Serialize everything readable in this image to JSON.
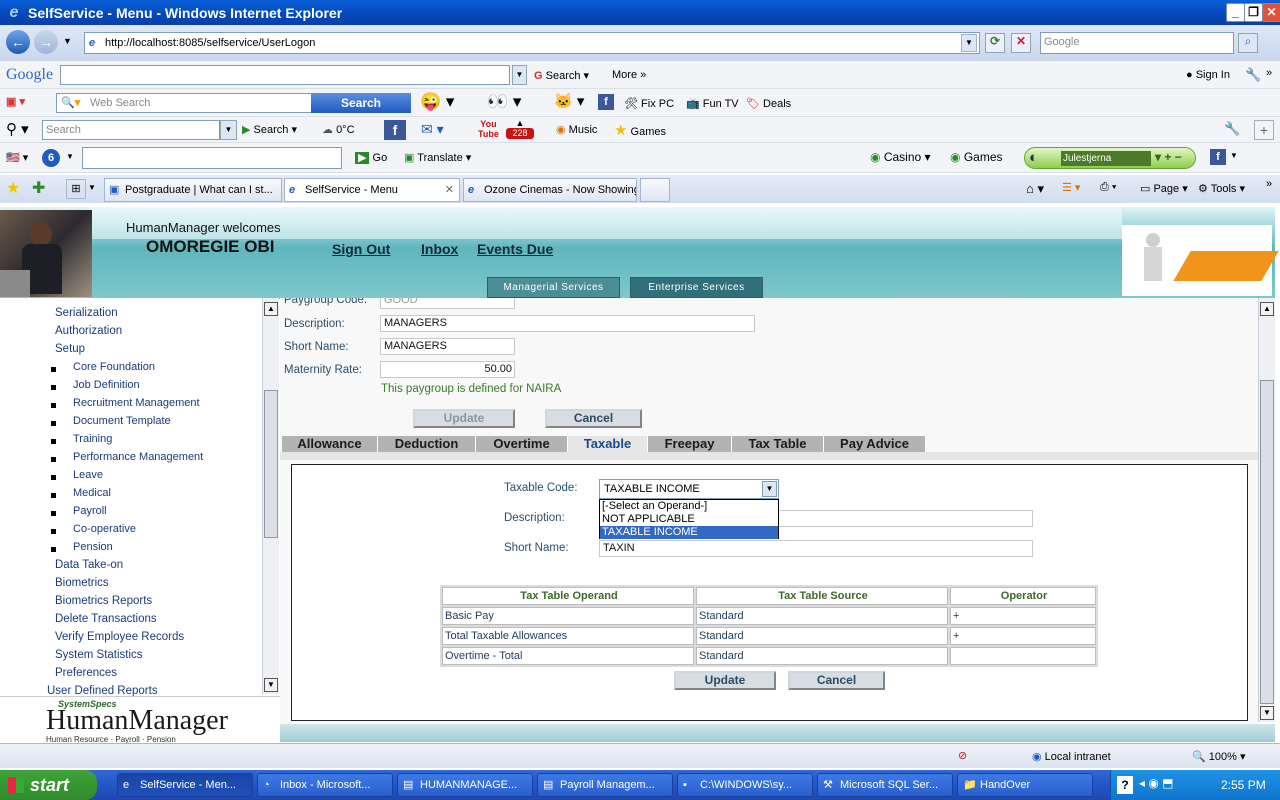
{
  "window": {
    "title": "SelfService - Menu - Windows Internet Explorer"
  },
  "address_bar": {
    "url": "http://localhost:8085/selfservice/UserLogon",
    "search_placeholder": "Google"
  },
  "google_bar": {
    "logo": "Google",
    "search_label": "Search",
    "more_label": "More",
    "sign_in": "Sign In"
  },
  "toolbar2": {
    "web_search_placeholder": "Web Search",
    "search_button": "Search",
    "fix_pc": "Fix PC",
    "fun_tv": "Fun TV",
    "deals": "Deals"
  },
  "toolbar3": {
    "search_placeholder": "Search",
    "search_label": "Search",
    "weather": "0°C",
    "youtube_badge": "228",
    "music": "Music",
    "games": "Games"
  },
  "toolbar4": {
    "go": "Go",
    "translate": "Translate",
    "casino": "Casino",
    "games": "Games",
    "user": "Julestjerna"
  },
  "ie_tabs": [
    {
      "label": "Postgraduate | What can I st..."
    },
    {
      "label": "SelfService - Menu"
    },
    {
      "label": "Ozone Cinemas - Now Showing"
    }
  ],
  "ie_cmd": {
    "page": "Page",
    "tools": "Tools"
  },
  "header": {
    "welcome": "HumanManager welcomes",
    "user_name": "OMOREGIE OBI",
    "links": [
      "Sign Out",
      "Inbox",
      "Events Due"
    ],
    "managerial": "Managerial Services",
    "enterprise": "Enterprise Services"
  },
  "sidebar": {
    "items": [
      "Serialization",
      "Authorization",
      "Setup"
    ],
    "setup_children": [
      "Core Foundation",
      "Job Definition",
      "Recruitment Management",
      "Document Template",
      "Training",
      "Performance Management",
      "Leave",
      "Medical",
      "Payroll",
      "Co-operative",
      "Pension"
    ],
    "more_items": [
      "Data Take-on",
      "Biometrics",
      "Biometrics Reports",
      "Delete Transactions",
      "Verify Employee Records",
      "System Statistics",
      "Preferences",
      "User Defined Reports"
    ],
    "logo_brand": "SystemSpecs",
    "logo_name": "HumanManager",
    "logo_tagline": "Human Resource · Payroll · Pension"
  },
  "form": {
    "paygroup_code_label": "Paygroup Code:",
    "paygroup_code_value": "GOOD",
    "description_label": "Description:",
    "description_value": "MANAGERS",
    "short_name_label": "Short Name:",
    "short_name_value": "MANAGERS",
    "maternity_label": "Maternity Rate:",
    "maternity_value": "50.00",
    "currency_note": "This paygroup is defined for NAIRA",
    "update": "Update",
    "cancel": "Cancel"
  },
  "tabs": [
    "Allowance",
    "Deduction",
    "Overtime",
    "Taxable",
    "Freepay",
    "Tax Table",
    "Pay Advice"
  ],
  "selected_tab": "Taxable",
  "taxable": {
    "code_label": "Taxable Code:",
    "code_value": "TAXABLE INCOME",
    "options": [
      "[-Select an Operand-]",
      "NOT APPLICABLE",
      "TAXABLE INCOME"
    ],
    "description_label": "Description:",
    "short_name_label": "Short Name:",
    "short_name_value": "TAXIN",
    "table_headers": [
      "Tax Table Operand",
      "Tax Table Source",
      "Operator"
    ],
    "rows": [
      [
        "Basic Pay",
        "Standard",
        "+"
      ],
      [
        "Total Taxable Allowances",
        "Standard",
        "+"
      ],
      [
        "Overtime - Total",
        "Standard",
        ""
      ]
    ],
    "update": "Update",
    "cancel": "Cancel"
  },
  "status_bar": {
    "zone": "Local intranet",
    "zoom": "100%"
  },
  "taskbar": {
    "start": "start",
    "tasks": [
      "SelfService - Men...",
      "Inbox - Microsoft...",
      "HUMANMANAGE...",
      "Payroll Managem...",
      "C:\\WINDOWS\\sy...",
      "Microsoft SQL Ser...",
      "HandOver"
    ],
    "clock": "2:55 PM"
  }
}
